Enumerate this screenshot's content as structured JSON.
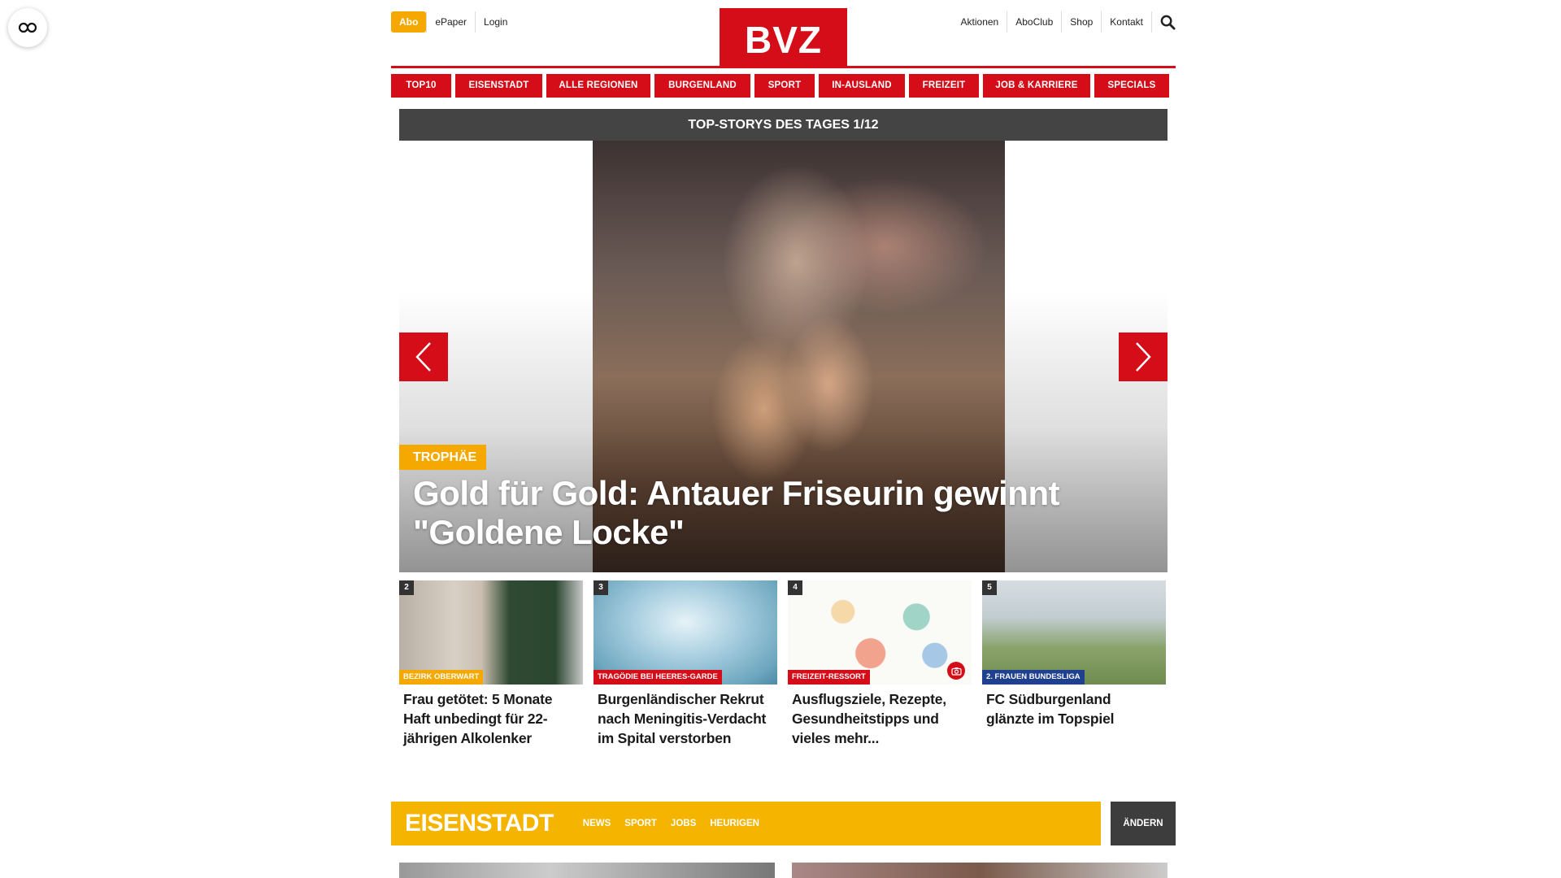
{
  "brand": {
    "logo": "BVZ",
    "accent": "#d50d19",
    "highlight": "#f5a800"
  },
  "utility": {
    "abo": "Abo",
    "epaper": "ePaper",
    "login": "Login",
    "right_links": [
      "Aktionen",
      "AboClub",
      "Shop",
      "Kontakt"
    ]
  },
  "nav": {
    "items": [
      "TOP10",
      "EISENSTADT",
      "ALLE REGIONEN",
      "BURGENLAND",
      "SPORT",
      "IN-AUSLAND",
      "FREIZEIT",
      "JOB & KARRIERE",
      "SPECIALS"
    ]
  },
  "top_stories": {
    "heading": "TOP-STORYS DES TAGES 1/12",
    "hero": {
      "tag": "TROPHÄE",
      "title": "Gold für Gold: Antauer Friseurin gewinnt \"Goldene Locke\""
    },
    "cards": [
      {
        "num": "2",
        "tag": "BEZIRK OBERWART",
        "tag_color": "#f5a800",
        "title": "Frau getötet: 5 Monate Haft unbedingt für 22-jährigen Alkolenker"
      },
      {
        "num": "3",
        "tag": "TRAGÖDIE BEI HEERES-GARDE",
        "tag_color": "#d50d19",
        "title": "Burgenländischer Rekrut nach Meningitis-Verdacht im Spital verstorben"
      },
      {
        "num": "4",
        "tag": "FREIZEIT-RESSORT",
        "tag_color": "#d50d19",
        "title": "Ausflugsziele, Rezepte, Gesundheitstipps und vieles mehr..."
      },
      {
        "num": "5",
        "tag": "2. FRAUEN BUNDESLIGA",
        "tag_color": "#1f3f8f",
        "title": "FC Südburgenland glänzte im Topspiel"
      }
    ]
  },
  "region": {
    "title": "EISENSTADT",
    "links": [
      "NEWS",
      "SPORT",
      "JOBS",
      "HEURIGEN"
    ],
    "change": "ÄNDERN"
  }
}
